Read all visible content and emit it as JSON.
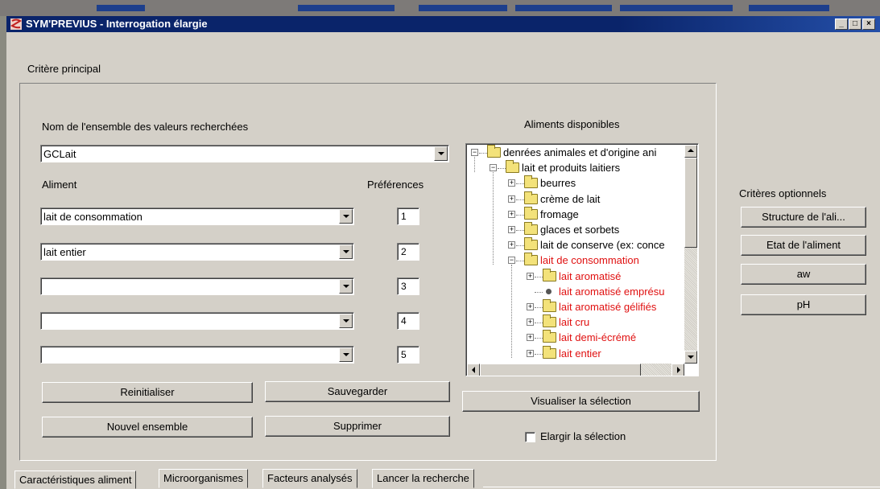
{
  "window": {
    "title": "SYM'PREVIUS - Interrogation élargie",
    "controls": [
      "minimize",
      "maximize",
      "close"
    ]
  },
  "main": {
    "section_label": "Critère principal",
    "ensemble_label": "Nom de l'ensemble des valeurs recherchées",
    "ensemble_value": "GCLait",
    "aliment_label": "Aliment",
    "preferences_label": "Préférences",
    "rows": [
      {
        "aliment": "lait de consommation",
        "pref": "1"
      },
      {
        "aliment": "lait entier",
        "pref": "2"
      },
      {
        "aliment": "",
        "pref": "3"
      },
      {
        "aliment": "",
        "pref": "4"
      },
      {
        "aliment": "",
        "pref": "5"
      }
    ],
    "buttons": {
      "reinitialiser": "Reinitialiser",
      "sauvegarder": "Sauvegarder",
      "nouvel_ensemble": "Nouvel ensemble",
      "supprimer": "Supprimer"
    }
  },
  "tree": {
    "title": "Aliments disponibles",
    "nodes": [
      {
        "label": "denrées animales et d'origine ani",
        "level": 0,
        "kind": "folder",
        "expander": "−",
        "red": false
      },
      {
        "label": "lait et produits laitiers",
        "level": 1,
        "kind": "folder",
        "expander": "−",
        "red": false
      },
      {
        "label": "beurres",
        "level": 2,
        "kind": "folder",
        "expander": "+",
        "red": false
      },
      {
        "label": "crème de lait",
        "level": 2,
        "kind": "folder",
        "expander": "+",
        "red": false
      },
      {
        "label": "fromage",
        "level": 2,
        "kind": "folder",
        "expander": "+",
        "red": false
      },
      {
        "label": "glaces et sorbets",
        "level": 2,
        "kind": "folder",
        "expander": "+",
        "red": false
      },
      {
        "label": "lait de conserve (ex: conce",
        "level": 2,
        "kind": "folder",
        "expander": "+",
        "red": false
      },
      {
        "label": "lait de consommation",
        "level": 2,
        "kind": "folder",
        "expander": "−",
        "red": true
      },
      {
        "label": "lait aromatisé",
        "level": 3,
        "kind": "folder",
        "expander": "+",
        "red": true
      },
      {
        "label": "lait aromatisé emprésu",
        "level": 3,
        "kind": "leaf",
        "expander": "",
        "red": true
      },
      {
        "label": "lait aromatisé gélifiés",
        "level": 3,
        "kind": "folder",
        "expander": "+",
        "red": true
      },
      {
        "label": "lait cru",
        "level": 3,
        "kind": "folder",
        "expander": "+",
        "red": true
      },
      {
        "label": "lait demi-écrémé",
        "level": 3,
        "kind": "folder",
        "expander": "+",
        "red": true
      },
      {
        "label": "lait entier",
        "level": 3,
        "kind": "folder",
        "expander": "+",
        "red": true
      }
    ],
    "visualiser_button": "Visualiser la sélection",
    "elargir_checkbox": {
      "label": "Elargir la sélection",
      "checked": false
    }
  },
  "optional": {
    "label": "Critères optionnels",
    "buttons": [
      "Structure de l'ali...",
      "Etat de l'aliment",
      "aw",
      "pH"
    ]
  },
  "tabs": [
    {
      "label": "Caractéristiques aliment",
      "active": true
    },
    {
      "label": "Microorganismes",
      "active": false
    },
    {
      "label": "Facteurs analysés",
      "active": false
    },
    {
      "label": "Lancer la recherche",
      "active": false
    }
  ],
  "colors": {
    "titlebar": "#0a246a",
    "window_bg": "#d4d0c8",
    "highlight_text": "#e01010",
    "folder": "#f3e27a"
  }
}
